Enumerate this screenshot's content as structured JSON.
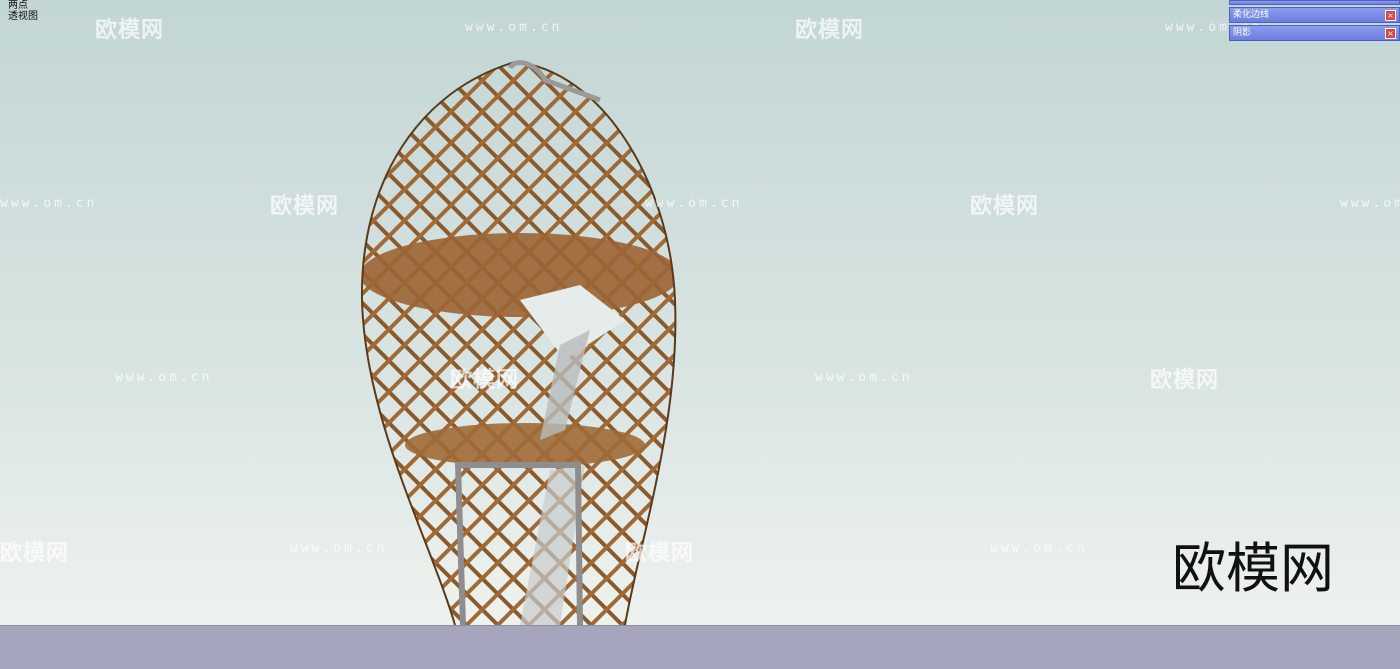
{
  "view": {
    "camera_lines": [
      "两点",
      "透视图"
    ]
  },
  "trays": [
    {
      "label": "柔化边线",
      "close_icon": "close-icon"
    },
    {
      "label": "阴影",
      "close_icon": "close-icon"
    }
  ],
  "watermark": {
    "logo_text": "欧模网",
    "url_text": "www.om.cn"
  },
  "brand_text": "欧模网",
  "colors": {
    "sky": "#c2d6d4",
    "ground": "#a5a6be",
    "wood": "#8a5a2b",
    "frame": "#9a9a9a",
    "tray": "#7586e6"
  }
}
